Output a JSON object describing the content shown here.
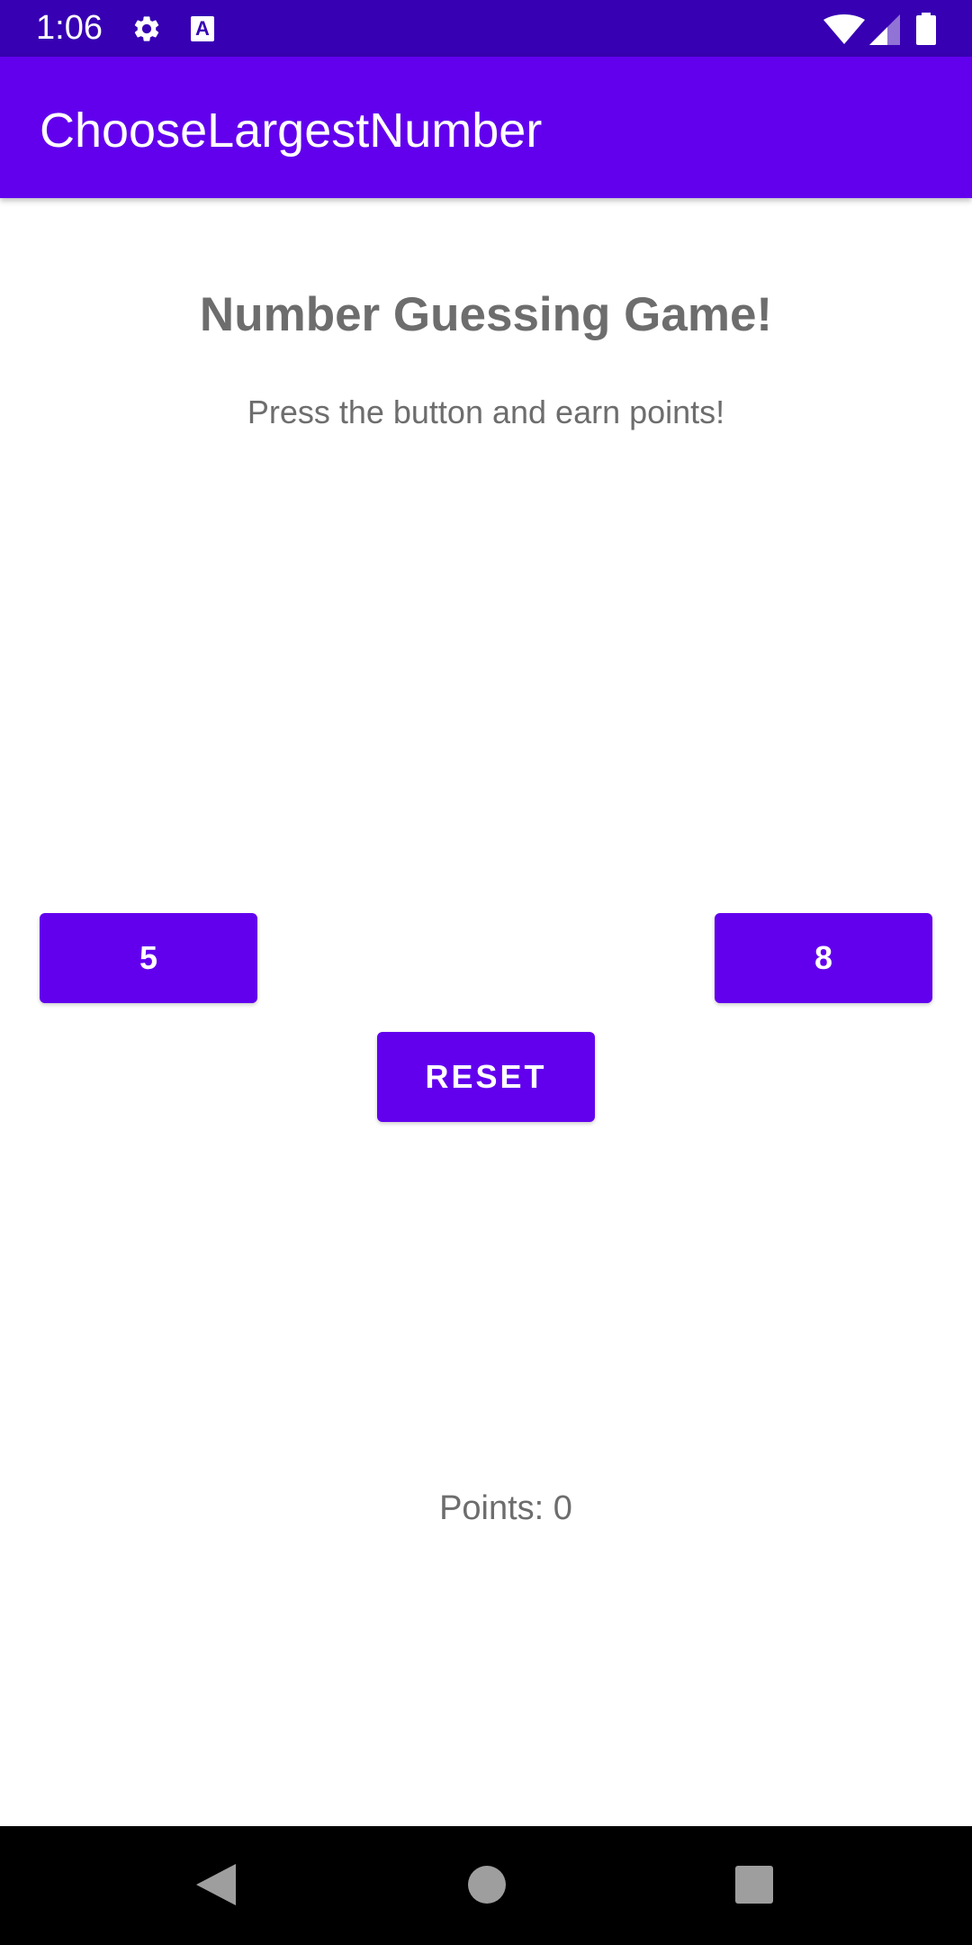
{
  "status_bar": {
    "time": "1:06",
    "icons": [
      "gear-icon",
      "a-notification-icon",
      "wifi-icon",
      "signal-icon",
      "battery-icon"
    ],
    "a_icon_letter": "A"
  },
  "app_bar": {
    "title": "ChooseLargestNumber",
    "color": "#6200ee"
  },
  "game": {
    "heading": "Number Guessing Game!",
    "subheading": "Press the button and earn points!",
    "left_button": "5",
    "right_button": "8",
    "reset_button": "RESET",
    "points_text": "Points: 0"
  },
  "nav_bar": {
    "icons": [
      "back-icon",
      "home-icon",
      "recents-icon"
    ]
  },
  "colors": {
    "status_bar": "#3700b3",
    "primary": "#6200ee",
    "text_gray": "#6d6d6d"
  }
}
